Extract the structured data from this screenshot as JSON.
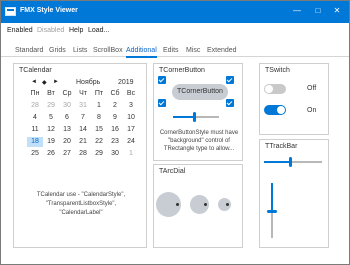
{
  "window": {
    "title": "FMX Style Viewer",
    "controls": {
      "minimize": "—",
      "maximize": "□",
      "close": "✕"
    }
  },
  "menu": {
    "enabled": "Enabled",
    "disabled": "Disabled",
    "help": "Help",
    "load": "Load..."
  },
  "tabs": [
    "Standard",
    "Grids",
    "Lists",
    "ScrollBox",
    "Additional",
    "Edits",
    "Misc",
    "Extended"
  ],
  "active_tab": "Additional",
  "calendar": {
    "title": "TCalendar",
    "nav": [
      "◄",
      "◆",
      "►"
    ],
    "month": "Ноябрь",
    "year": "2019",
    "weekdays": [
      "Пн",
      "Вт",
      "Ср",
      "Чт",
      "Пт",
      "Сб",
      "Вс"
    ],
    "weeks": [
      [
        "28",
        "29",
        "30",
        "31",
        "1",
        "2",
        "3"
      ],
      [
        "4",
        "5",
        "6",
        "7",
        "8",
        "9",
        "10"
      ],
      [
        "11",
        "12",
        "13",
        "14",
        "15",
        "16",
        "17"
      ],
      [
        "18",
        "19",
        "20",
        "21",
        "22",
        "23",
        "24"
      ],
      [
        "25",
        "26",
        "27",
        "28",
        "29",
        "30",
        "1"
      ]
    ],
    "selected_day": "18",
    "footer": "TCalendar use - \"CalendarStyle\", \"TransparentListboxStyle\", \"CalendarLabel\""
  },
  "corner_button": {
    "title": "TCornerButton",
    "button_label": "TCornerButton",
    "slider_value": 0.45,
    "note": "CornerButtonStyle must have \"background\" control of TRectangle type to allow..."
  },
  "arc_dial": {
    "title": "TArcDial"
  },
  "switch": {
    "title": "TSwitch",
    "items": [
      {
        "state": "off",
        "label": "Off"
      },
      {
        "state": "on",
        "label": "On"
      }
    ]
  },
  "trackbar": {
    "title": "TTrackBar",
    "horizontal_value": 0.45,
    "vertical_value": 0.5
  },
  "colors": {
    "accent": "#0078d7",
    "selected_day_bg": "#bfe0f8"
  }
}
